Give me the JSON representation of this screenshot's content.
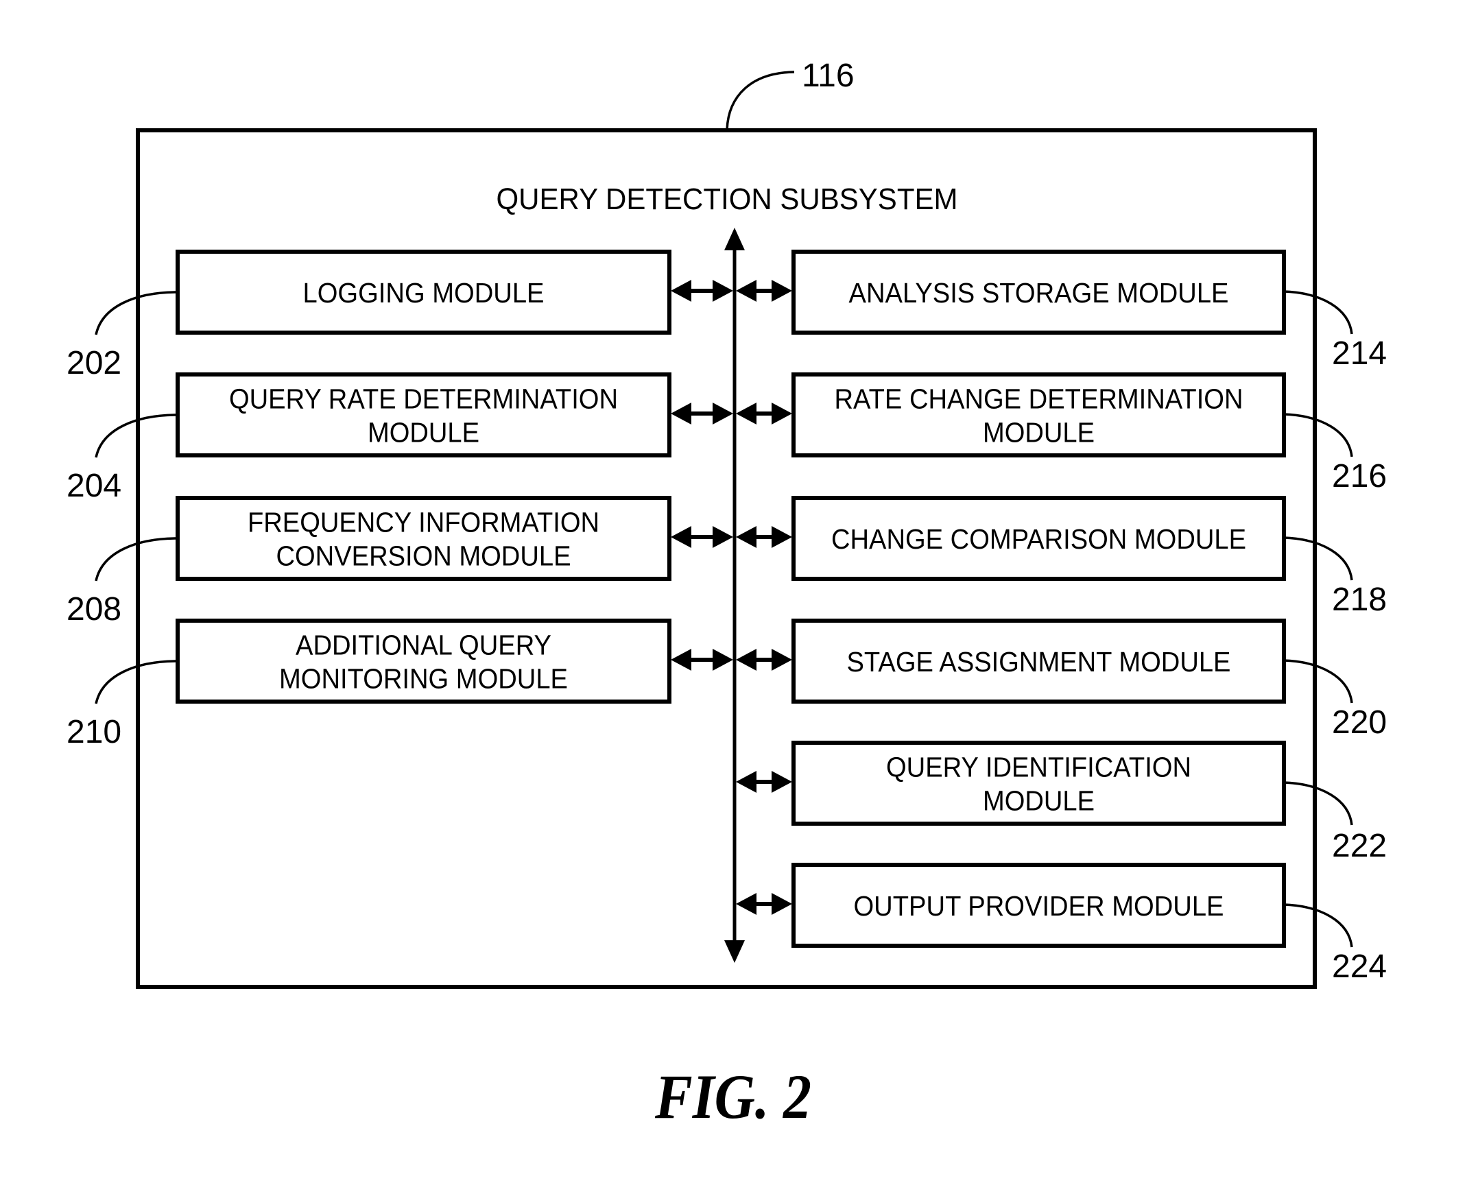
{
  "figure": {
    "caption": "FIG. 2",
    "subsystem": {
      "ref": "116",
      "title": "QUERY DETECTION SUBSYSTEM"
    },
    "left_modules": [
      {
        "ref": "202",
        "lines": [
          "LOGGING MODULE"
        ]
      },
      {
        "ref": "204",
        "lines": [
          "QUERY RATE DETERMINATION",
          "MODULE"
        ]
      },
      {
        "ref": "208",
        "lines": [
          "FREQUENCY INFORMATION",
          "CONVERSION MODULE"
        ]
      },
      {
        "ref": "210",
        "lines": [
          "ADDITIONAL QUERY",
          "MONITORING MODULE"
        ]
      }
    ],
    "right_modules": [
      {
        "ref": "214",
        "lines": [
          "ANALYSIS STORAGE MODULE"
        ]
      },
      {
        "ref": "216",
        "lines": [
          "RATE CHANGE DETERMINATION",
          "MODULE"
        ]
      },
      {
        "ref": "218",
        "lines": [
          "CHANGE COMPARISON MODULE"
        ]
      },
      {
        "ref": "220",
        "lines": [
          "STAGE ASSIGNMENT MODULE"
        ]
      },
      {
        "ref": "222",
        "lines": [
          "QUERY IDENTIFICATION",
          "MODULE"
        ]
      },
      {
        "ref": "224",
        "lines": [
          "OUTPUT PROVIDER MODULE"
        ]
      }
    ],
    "connections": {
      "bus": "bidirectional",
      "module_links": "bidirectional"
    }
  }
}
